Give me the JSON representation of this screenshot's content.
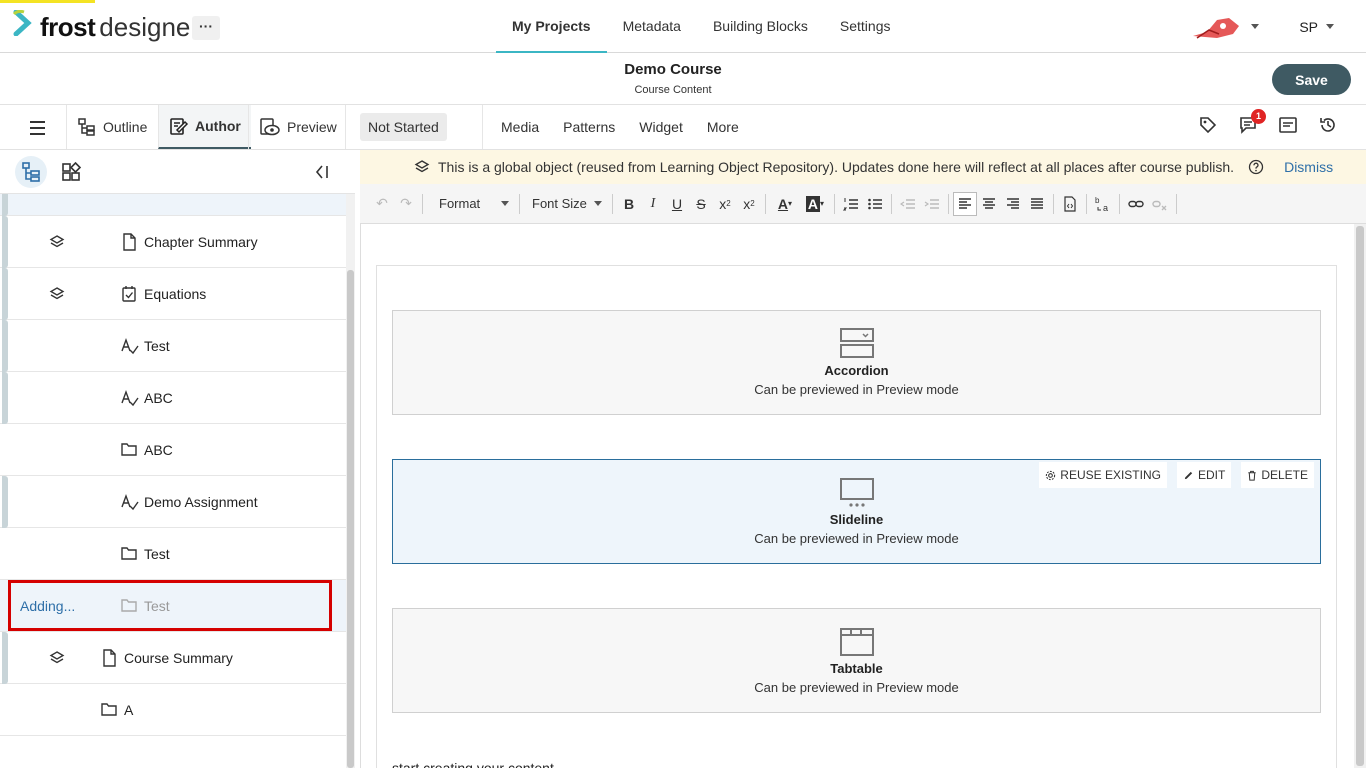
{
  "app": {
    "logo_word1": "frost",
    "logo_word2": "designer",
    "more_label": "···"
  },
  "nav": {
    "items": [
      "My Projects",
      "Metadata",
      "Building Blocks",
      "Settings"
    ],
    "active": "My Projects"
  },
  "user": {
    "initials": "SP"
  },
  "course": {
    "title": "Demo Course",
    "subtitle": "Course Content",
    "save_label": "Save"
  },
  "modes": {
    "outline": "Outline",
    "author": "Author",
    "preview": "Preview",
    "status": "Not Started"
  },
  "tools": [
    "Media",
    "Patterns",
    "Widget",
    "More"
  ],
  "notifications": {
    "count": "1"
  },
  "banner": {
    "message": "This is a global object (reused from Learning Object Repository). Updates done here will reflect at all places after course publish.",
    "dismiss": "Dismiss"
  },
  "toolbar": {
    "format": "Format",
    "font_size": "Font Size",
    "bold": "B",
    "italic": "I",
    "underline": "U",
    "strike": "S"
  },
  "tree": {
    "rows": [
      {
        "label": "Chapter Summary",
        "icon": "document-icon"
      },
      {
        "label": "Equations",
        "icon": "checkbox-icon"
      },
      {
        "label": "Test",
        "icon": "assessment-icon"
      },
      {
        "label": "ABC",
        "icon": "assessment-icon"
      },
      {
        "label": "ABC",
        "icon": "folder-icon"
      },
      {
        "label": "Demo Assignment",
        "icon": "assessment-icon"
      },
      {
        "label": "Test",
        "icon": "folder-icon"
      },
      {
        "label": "Test",
        "icon": "folder-icon",
        "status": "Adding..."
      },
      {
        "label": "Course Summary",
        "icon": "document-icon"
      },
      {
        "label": "A",
        "icon": "folder-icon"
      }
    ]
  },
  "blocks": [
    {
      "name": "Accordion",
      "note": "Can be previewed in Preview mode",
      "icon": "accordion-icon"
    },
    {
      "name": "Slideline",
      "note": "Can be previewed in Preview mode",
      "icon": "slideline-icon"
    },
    {
      "name": "Tabtable",
      "note": "Can be previewed in Preview mode",
      "icon": "tabtable-icon"
    }
  ],
  "block_actions": {
    "reuse": "REUSE EXISTING",
    "edit": "EDIT",
    "delete": "DELETE"
  },
  "editor": {
    "placeholder_text": "start creating your content"
  },
  "colors": {
    "accent": "#3bb6c4",
    "save_bg": "#3f5a63",
    "badge": "#e02424",
    "link": "#2e6fa8",
    "highlight_box": "#d50000",
    "banner_bg": "#fdf7e3"
  }
}
